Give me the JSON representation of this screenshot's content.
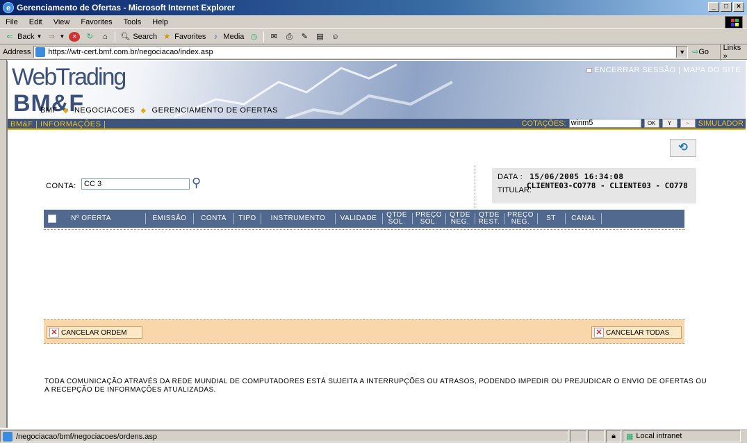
{
  "window": {
    "title": "Gerenciamento de Ofertas - Microsoft Internet Explorer",
    "controls": [
      "_",
      "□",
      "×"
    ]
  },
  "menu": [
    "File",
    "Edit",
    "View",
    "Favorites",
    "Tools",
    "Help"
  ],
  "toolbar": {
    "back": "Back",
    "search": "Search",
    "favorites": "Favorites",
    "media": "Media"
  },
  "address": {
    "label": "Address",
    "url": "https://wtr-cert.bmf.com.br/negociacao/index.asp",
    "go": "Go",
    "links": "Links"
  },
  "site": {
    "logo_line1": "WebTrading",
    "logo_line2": "BM&F",
    "top_links": "ENCERRAR SESSÃO | MAPA DO SITE",
    "nav_left": "BM&F | INFORMAÇÕES |",
    "quotes_label": "COTAÇÕES:",
    "quotes_value": "winm5",
    "ok": "OK",
    "simulator": "SIMULADOR"
  },
  "breadcrumb": [
    "BMF",
    "NEGOCIACOES",
    "GERENCIAMENTO DE OFERTAS"
  ],
  "account": {
    "label": "CONTA:",
    "value": "CC 3"
  },
  "info": {
    "date_label": "DATA :",
    "date_value": "15/06/2005 16:34:08",
    "holder_label": "TITULAR:",
    "holder_value": "CLIENTE03-CO778 - CLIENTE03 - CO778"
  },
  "table": {
    "columns": [
      {
        "l1": "",
        "l2": "Nº OFERTA"
      },
      {
        "l1": "",
        "l2": "EMISSÃO"
      },
      {
        "l1": "",
        "l2": "CONTA"
      },
      {
        "l1": "",
        "l2": "TIPO"
      },
      {
        "l1": "",
        "l2": "INSTRUMENTO"
      },
      {
        "l1": "",
        "l2": "VALIDADE"
      },
      {
        "l1": "QTDE",
        "l2": "SOL."
      },
      {
        "l1": "PREÇO",
        "l2": "SOL."
      },
      {
        "l1": "QTDE",
        "l2": "NEG."
      },
      {
        "l1": "QTDE",
        "l2": "REST."
      },
      {
        "l1": "PREÇO",
        "l2": "NEG."
      },
      {
        "l1": "",
        "l2": "ST"
      },
      {
        "l1": "",
        "l2": "CANAL"
      }
    ]
  },
  "actions": {
    "cancel_order": "CANCELAR ORDEM",
    "cancel_all": "CANCELAR TODAS"
  },
  "disclaimer": "TODA COMUNICAÇÃO ATRAVÉS DA REDE MUNDIAL DE COMPUTADORES ESTÁ SUJEITA A INTERRUPÇÕES OU ATRASOS, PODENDO IMPEDIR OU PREJUDICAR O ENVIO DE OFERTAS OU A RECEPÇÃO DE INFORMAÇÕES ATUALIZADAS.",
  "status": {
    "text": "/negociacao/bmf/negociacoes/ordens.asp",
    "zone": "Local intranet"
  },
  "icons": {
    "ie": "ie-logo-icon",
    "refresh": "refresh-icon",
    "search": "magnifier-icon",
    "cancel": "cancel-x-icon"
  }
}
